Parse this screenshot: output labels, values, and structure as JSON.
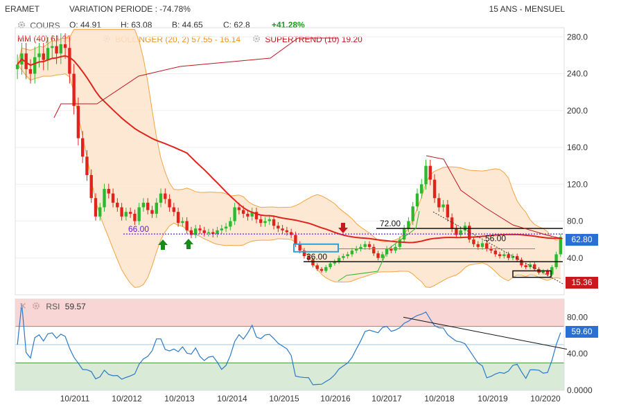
{
  "header": {
    "instrument": "ERAMET",
    "variation": "VARIATION PERIODE : -74.78%",
    "period": "15 ANS - MENSUEL"
  },
  "legend": {
    "cours_label": "COURS",
    "open": "O: 44.91",
    "high": "H: 63.08",
    "low": "B: 44.65",
    "close": "C: 62.8",
    "change": "+41.28%",
    "mm": "MM (40) 61.99",
    "bollinger": "BOLLINGER (20, 2) 57.55 - 16.14",
    "supertrend": "SUPERTREND (10) 19.20"
  },
  "colors": {
    "up": "#2db82d",
    "down": "#e0231b",
    "mm": "#e0231b",
    "bollinger_fill": "#fde4cc",
    "bollinger_line": "#f4a340",
    "supertrend_down": "#c0141b",
    "supertrend_up": "#2db82d",
    "support": "#6a1fd0",
    "rsi_line": "#2a78c8",
    "rsi_upper_zone": "#f8d6d6",
    "rsi_lower_zone": "#d9ead7",
    "price_badge": "#2a6fd4",
    "stop_badge": "#c8171d"
  },
  "rsi_panel": {
    "label": "RSI",
    "value": "59.57",
    "badge": "59.60",
    "overbought": 70,
    "oversold": 30
  },
  "badges": {
    "price": "62.80",
    "supertrend": "15.36"
  },
  "annotations": [
    {
      "text": "66.00",
      "price": 66
    },
    {
      "text": "72.00",
      "price": 72
    },
    {
      "text": "36.00",
      "price": 36
    },
    {
      "text": "56.00",
      "price": 56
    }
  ],
  "chart_data": {
    "type": "candlestick",
    "price_axis": {
      "ylim": [
        0,
        290
      ],
      "ticks": [
        "40.0",
        "80.0",
        "120.0",
        "160.0",
        "200.0",
        "240.0",
        "280.0"
      ]
    },
    "rsi_axis": {
      "ylim": [
        0,
        100
      ],
      "ticks": [
        "0.0000",
        "40.00",
        "80.00"
      ]
    },
    "x_tick_labels": [
      "10/2011",
      "10/2012",
      "10/2013",
      "10/2014",
      "10/2015",
      "10/2016",
      "10/2017",
      "10/2018",
      "10/2019",
      "10/2020"
    ],
    "start": "2010-03",
    "close_monthly": [
      250,
      262,
      245,
      240,
      258,
      262,
      255,
      268,
      270,
      262,
      272,
      268,
      240,
      205,
      170,
      150,
      130,
      105,
      85,
      95,
      115,
      110,
      100,
      95,
      85,
      90,
      88,
      80,
      95,
      100,
      92,
      88,
      100,
      110,
      104,
      95,
      90,
      78,
      80,
      70,
      65,
      72,
      70,
      67,
      68,
      66,
      70,
      72,
      74,
      80,
      95,
      92,
      88,
      85,
      90,
      82,
      78,
      80,
      82,
      75,
      72,
      70,
      68,
      65,
      55,
      48,
      42,
      38,
      32,
      28,
      26,
      30,
      34,
      36,
      40,
      42,
      44,
      48,
      50,
      52,
      55,
      52,
      45,
      40,
      44,
      50,
      48,
      52,
      60,
      72,
      80,
      96,
      110,
      120,
      140,
      125,
      105,
      95,
      98,
      84,
      72,
      65,
      70,
      75,
      60,
      55,
      52,
      56,
      50,
      48,
      44,
      42,
      44,
      40,
      42,
      38,
      32,
      30,
      33,
      28,
      24,
      26,
      22,
      30,
      44,
      62.8
    ],
    "annotated_levels": [
      66,
      72,
      36,
      56
    ]
  }
}
